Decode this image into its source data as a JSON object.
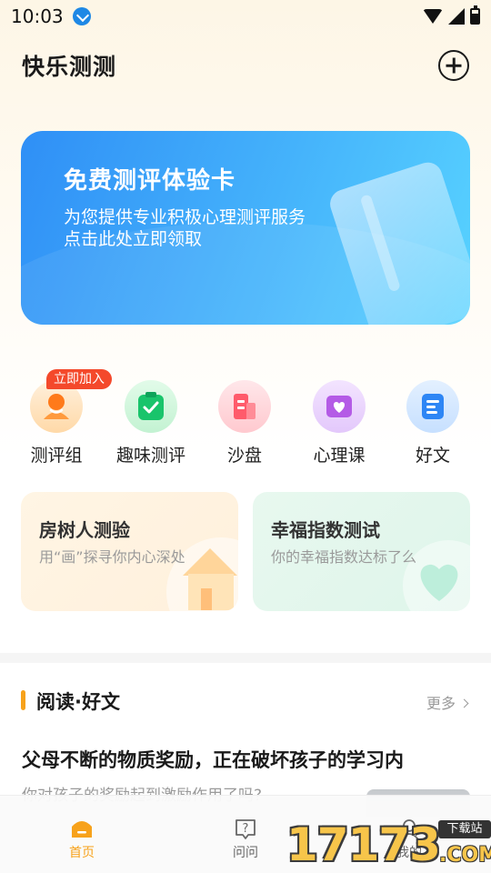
{
  "status_bar": {
    "time": "10:03"
  },
  "header": {
    "title": "快乐测测"
  },
  "banner": {
    "title": "免费测评体验卡",
    "subtitle_line1": "为您提供专业积极心理测评服务",
    "subtitle_line2": "点击此处立即领取"
  },
  "quick_nav": {
    "badge": "立即加入",
    "items": [
      {
        "label": "测评组",
        "icon": "group-icon"
      },
      {
        "label": "趣味测评",
        "icon": "clipboard-check-icon"
      },
      {
        "label": "沙盘",
        "icon": "sandbox-icon"
      },
      {
        "label": "心理课",
        "icon": "heart-course-icon"
      },
      {
        "label": "好文",
        "icon": "article-icon"
      }
    ]
  },
  "feature_cards": [
    {
      "title": "房树人测验",
      "subtitle": "用“画”探寻你内心深处"
    },
    {
      "title": "幸福指数测试",
      "subtitle": "你的幸福指数达标了么"
    }
  ],
  "reading_section": {
    "title": "阅读·好文",
    "more": "更多"
  },
  "article": {
    "title": "父母不断的物质奖励，正在破坏孩子的学习内",
    "subtitle": "你对孩子的奖励起到激励作用了吗?"
  },
  "tabbar": {
    "items": [
      {
        "label": "首页",
        "active": true
      },
      {
        "label": "问问",
        "active": false
      },
      {
        "label": "我的",
        "active": false
      }
    ]
  },
  "watermark": {
    "digits": "17173",
    "badge": "下载站",
    "suffix": ".COM"
  },
  "colors": {
    "accent_orange": "#f7a21b",
    "banner_blue": "#2f8ff6",
    "badge_red": "#f4492b"
  }
}
